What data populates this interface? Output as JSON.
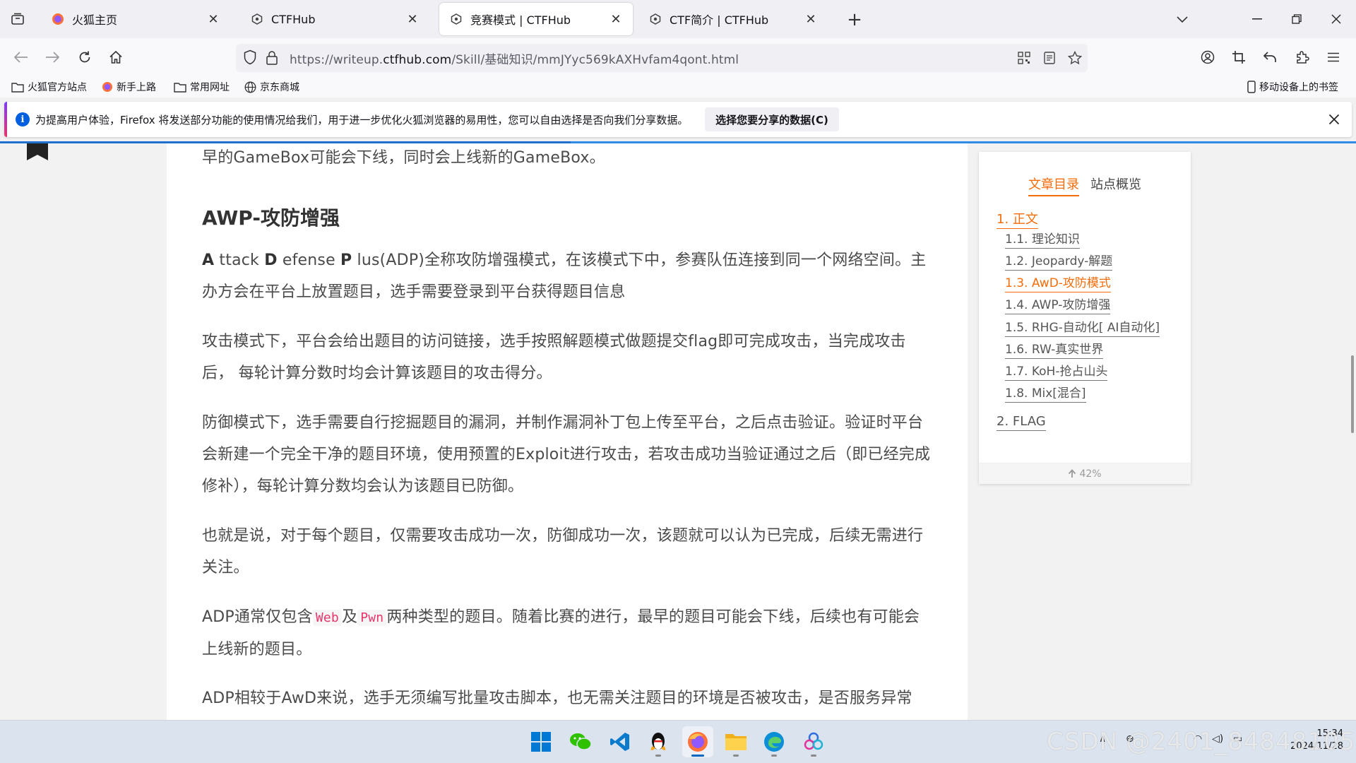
{
  "tabs": [
    {
      "title": "火狐主页"
    },
    {
      "title": "CTFHub"
    },
    {
      "title": "竞赛模式 | CTFHub"
    },
    {
      "title": "CTF简介 | CTFHub"
    }
  ],
  "address": {
    "prefix": "https://writeup.",
    "domain": "ctfhub.com",
    "path": "/Skill/基础知识/mmJYyc569kAXHvfam4qont.html"
  },
  "bookmarks": [
    {
      "label": "火狐官方站点"
    },
    {
      "label": "新手上路"
    },
    {
      "label": "常用网址"
    },
    {
      "label": "京东商城"
    }
  ],
  "mobile_bookmarks": "移动设备上的书签",
  "notification": {
    "message": "为提高用户体验，Firefox 将发送部分功能的使用情况给我们，用于进一步优化火狐浏览器的易用性，您可以自由选择是否向我们分享数据。",
    "button": "选择您要分享的数据(C)"
  },
  "article": {
    "p0": "早的GameBox可能会下线，同时会上线新的GameBox。",
    "h_awp": "AWP-攻防增强",
    "p1_a": "A",
    "p1_b": " ttack ",
    "p1_c": "D",
    "p1_d": " efense ",
    "p1_e": "P",
    "p1_f": " lus(ADP)全称攻防增强模式，在该模式下中，参赛队伍连接到同一个网络空间。主办方会在平台上放置题目，选手需要登录到平台获得题目信息",
    "p2": "攻击模式下，平台会给出题目的访问链接，选手按照解题模式做题提交flag即可完成攻击，当完成攻击后， 每轮计算分数时均会计算该题目的攻击得分。",
    "p3": "防御模式下，选手需要自行挖掘题目的漏洞，并制作漏洞补丁包上传至平台，之后点击验证。验证时平台会新建一个完全干净的题目环境，使用预置的Exploit进行攻击，若攻击成功当验证通过之后（即已经完成修补），每轮计算分数均会认为该题目已防御。",
    "p4": "也就是说，对于每个题目，仅需要攻击成功一次，防御成功一次，该题就可以认为已完成，后续无需进行关注。",
    "p5_a": "ADP通常仅包含",
    "p5_code1": "Web",
    "p5_b": "及",
    "p5_code2": "Pwn",
    "p5_c": "两种类型的题目。随着比赛的进行，最早的题目可能会下线，后续也有可能会上线新的题目。",
    "p6": "ADP相较于AwD来说，选手无须编写批量攻击脚本，也无需关注题目的环境是否被攻击，是否服务异常"
  },
  "toc": {
    "tab_toc": "文章目录",
    "tab_overview": "站点概览",
    "items": [
      {
        "label": "1. 正文"
      },
      {
        "label": "1.1. 理论知识"
      },
      {
        "label": "1.2. Jeopardy-解题"
      },
      {
        "label": "1.3. AwD-攻防模式"
      },
      {
        "label": "1.4. AWP-攻防增强"
      },
      {
        "label": "1.5. RHG-自动化[ AI自动化]"
      },
      {
        "label": "1.6. RW-真实世界"
      },
      {
        "label": "1.7. KoH-抢占山头"
      },
      {
        "label": "1.8. Mix[混合]"
      },
      {
        "label": "2. FLAG"
      }
    ],
    "progress": "42%"
  },
  "taskbar": {
    "clock_time": "15:34",
    "clock_date": "2024/11/28",
    "watermark": "CSDN @2401_84848105"
  },
  "colors": {
    "accent": "#f56c0a",
    "browser_blue": "#0060df"
  }
}
